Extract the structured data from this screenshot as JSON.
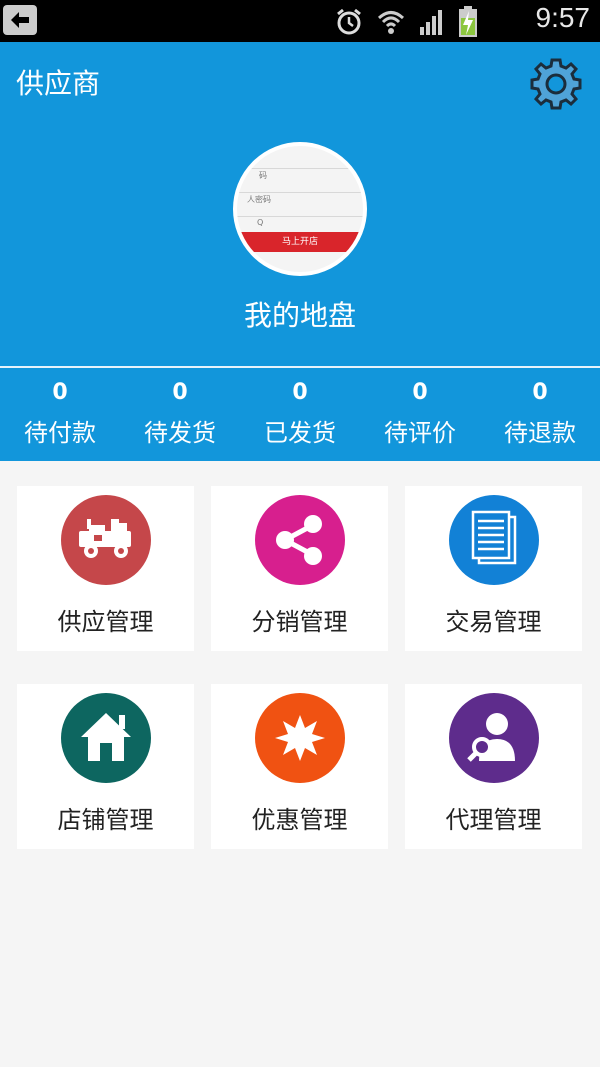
{
  "status_bar": {
    "time": "9:57"
  },
  "header": {
    "title": "供应商",
    "store_name": "我的地盘"
  },
  "avatar_image": {
    "line1": "码",
    "line2": "人密码",
    "line3": "Q",
    "button": "马上开店"
  },
  "stats": [
    {
      "value": "0",
      "label": "待付款"
    },
    {
      "value": "0",
      "label": "待发货"
    },
    {
      "value": "0",
      "label": "已发货"
    },
    {
      "value": "0",
      "label": "待评价"
    },
    {
      "value": "0",
      "label": "待退款"
    }
  ],
  "menu": [
    {
      "label": "供应管理",
      "icon": "truck-icon",
      "color": "#c5474a"
    },
    {
      "label": "分销管理",
      "icon": "share-icon",
      "color": "#d71f8e"
    },
    {
      "label": "交易管理",
      "icon": "document-icon",
      "color": "#1281d6"
    },
    {
      "label": "店铺管理",
      "icon": "home-icon",
      "color": "#0d6660"
    },
    {
      "label": "优惠管理",
      "icon": "starburst-icon",
      "color": "#f05212"
    },
    {
      "label": "代理管理",
      "icon": "agent-icon",
      "color": "#5e2c8c"
    }
  ]
}
